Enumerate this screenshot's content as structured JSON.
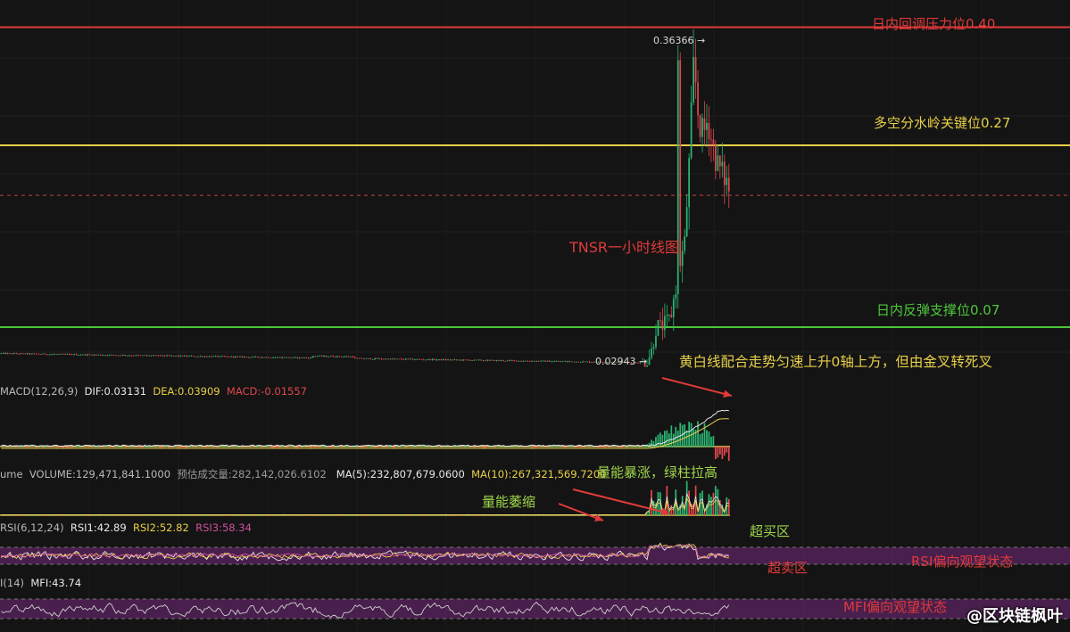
{
  "chart_data": {
    "type": "candlestick",
    "title": "TNSR一小时线图",
    "price": {
      "high_label": "0.36366",
      "low_label": "0.02943",
      "high": 0.36366,
      "low": 0.02943,
      "last": 0.215,
      "ylim": [
        0.018,
        0.424
      ],
      "series_shape": [
        0.04,
        0.04,
        0.038,
        0.036,
        0.036,
        0.035,
        0.035,
        0.034,
        0.034,
        0.033,
        0.033,
        0.032,
        0.031,
        0.03,
        0.029,
        0.03,
        0.034,
        0.045,
        0.072,
        0.07,
        0.075,
        0.08,
        0.11,
        0.14,
        0.16,
        0.25,
        0.363,
        0.3,
        0.28,
        0.3,
        0.27,
        0.25,
        0.24,
        0.23,
        0.215
      ]
    },
    "levels": [
      {
        "label": "日内回调压力位0.40",
        "value": 0.4,
        "color": "#e03a3a"
      },
      {
        "label": "多空分水岭关键位0.27",
        "value": 0.27,
        "color": "#e8d048"
      },
      {
        "label": "日内反弹支撑位0.07",
        "value": 0.07,
        "color": "#4cc63a"
      }
    ],
    "macd": {
      "label": "MACD(12,26,9)",
      "dif": "DIF:0.03131",
      "dea": "DEA:0.03909",
      "macd": "MACD:-0.01557"
    },
    "volume": {
      "label": "ume",
      "volume": "VOLUME:129,471,841.1000",
      "est": "预估成交量:282,142,026.6102",
      "ma5": "MA(5):232,807,679.0600",
      "ma10": "MA(10):267,321,569.7200"
    },
    "rsi": {
      "label": "RSI(6,12,24)",
      "rsi1": "RSI1:42.89",
      "rsi2": "RSI2:52.82",
      "rsi3": "RSI3:58.34"
    },
    "mfi": {
      "label": "I(14)",
      "value": "MFI:43.74"
    }
  },
  "annotations": {
    "macd_note": "黄白线配合走势匀速上升0轴上方，但由金叉转死叉",
    "vol_up": "量能暴涨，绿柱拉高",
    "vol_down": "量能萎缩",
    "overbought": "超买区",
    "oversold": "超卖区",
    "rsi_state": "RSI偏向观望状态",
    "mfi_state": "MFI偏向观望状态"
  },
  "watermark": "@区块链枫叶",
  "colors": {
    "up": "#2bb673",
    "down": "#e0474c",
    "yellow": "#e8d048",
    "white": "#e8e8e8",
    "pink": "#d04fa0"
  }
}
